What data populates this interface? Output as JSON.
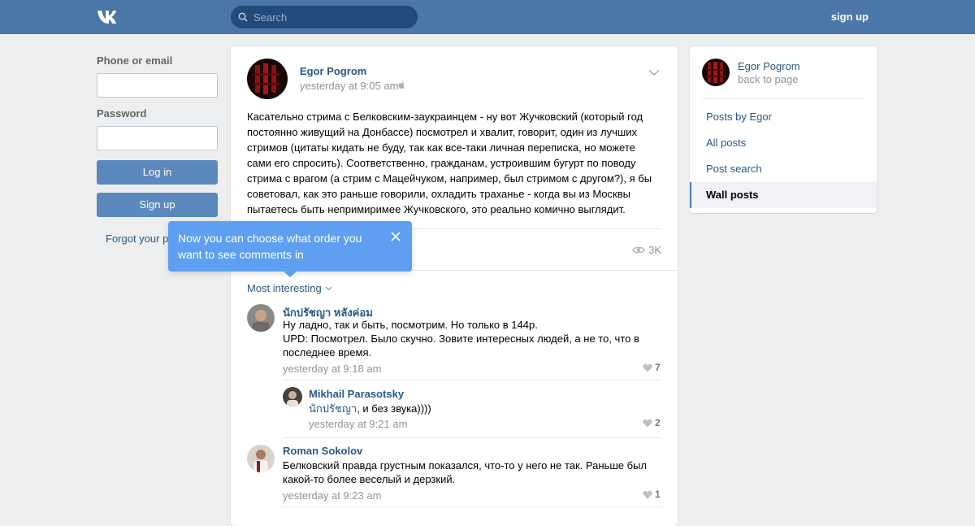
{
  "header": {
    "logo_text": "VK",
    "search_placeholder": "Search",
    "signup_label": "sign up"
  },
  "login": {
    "phone_label": "Phone or email",
    "password_label": "Password",
    "login_button": "Log in",
    "signup_button": "Sign up",
    "forgot_label": "Forgot your pa"
  },
  "tooltip": {
    "text": "Now you can choose what order you want to see comments in"
  },
  "post": {
    "author": "Egor Pogrom",
    "time": "yesterday at 9:05 am",
    "text": "Касательно стрима с Белковским-заукраинцем - ну вот Жучковский (который год постоянно живущий на Донбассе) посмотрел и хвалит, говорит, один из лучших стримов (цитаты кидать не буду, так как все-таки личная переписка, но можете сами его спросить). Соответственно, гражданам, устроившим бугурт по поводу стрима с врагом (а стрим с Мацейчуком, например, был стримом с другом?), я бы советовал, как это раньше говорили, охладить траханье - когда вы из Москвы пытаетесь быть непримиримее Жучковского, это реально комично выглядит.",
    "views": "3K"
  },
  "comments": {
    "sort_label": "Most interesting",
    "items": [
      {
        "name": "นักปรัชญา หลังค่อม",
        "line1": "Ну ладно, так и быть, посмотрим. Но только в 144р.",
        "line2": "UPD: Посмотрел. Было скучно. Зовите интересных людей, а не то, что в последнее время.",
        "time": "yesterday at 9:18 am",
        "likes": "7"
      },
      {
        "name": "Mikhail Parasotsky",
        "mention": "นักปรัชญา",
        "text": ", и без звука))))",
        "time": "yesterday at 9:21 am",
        "likes": "2"
      },
      {
        "name": "Roman Sokolov",
        "text": "Белковский правда грустным показался, что-то у него не так. Раньше был какой-то более веселый и дерзкий.",
        "time": "yesterday at 9:23 am",
        "likes": "1"
      }
    ]
  },
  "sidebar": {
    "name": "Egor Pogrom",
    "back": "back to page",
    "items": [
      {
        "label": "Posts by Egor"
      },
      {
        "label": "All posts"
      },
      {
        "label": "Post search"
      },
      {
        "label": "Wall posts"
      }
    ]
  },
  "colors": {
    "header_bg": "#4a76a8",
    "link": "#2a5885",
    "button": "#5b88bd",
    "tooltip_bg": "#5e9ff2"
  }
}
